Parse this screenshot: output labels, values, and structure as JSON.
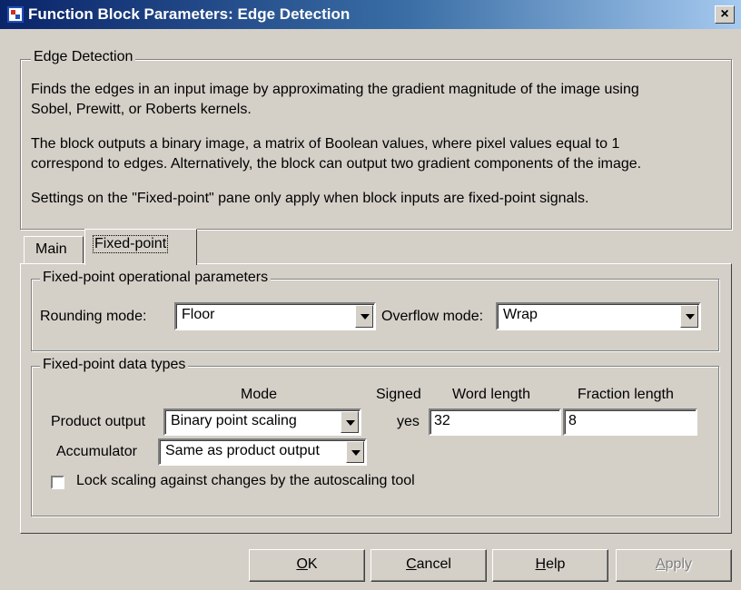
{
  "window": {
    "title": "Function Block Parameters: Edge Detection",
    "close_label": "×",
    "icon": "simulink-block-icon"
  },
  "description": {
    "group_title": "Edge Detection",
    "line1": "Finds the edges in an input image by approximating the gradient magnitude of the image using",
    "line2": "Sobel, Prewitt, or Roberts kernels.",
    "line3": "The block outputs a binary image, a matrix of Boolean values, where pixel values equal to 1",
    "line4": "correspond to edges.  Alternatively, the block can output two gradient components of the image.",
    "line5": "Settings on the \"Fixed-point\" pane only apply when block inputs are fixed-point signals."
  },
  "tabs": [
    {
      "label": "Main",
      "active": false
    },
    {
      "label": "Fixed-point",
      "active": true
    }
  ],
  "operational": {
    "group_title": "Fixed-point operational parameters",
    "rounding_label": "Rounding mode:",
    "rounding_value": "Floor",
    "overflow_label": "Overflow mode:",
    "overflow_value": "Wrap"
  },
  "datatypes": {
    "group_title": "Fixed-point data types",
    "headers": {
      "mode": "Mode",
      "signed": "Signed",
      "word_length": "Word length",
      "fraction_length": "Fraction length"
    },
    "product": {
      "label": "Product output",
      "mode": "Binary point scaling",
      "signed": "yes",
      "word_length": "32",
      "fraction_length": "8"
    },
    "accumulator": {
      "label": "Accumulator",
      "mode": "Same as product output"
    },
    "lock_label": "Lock scaling against changes by the autoscaling tool",
    "lock_checked": false
  },
  "buttons": {
    "ok": {
      "mnemonic": "O",
      "rest": "K"
    },
    "cancel": {
      "mnemonic": "C",
      "rest": "ancel"
    },
    "help": {
      "mnemonic": "H",
      "rest": "elp"
    },
    "apply": {
      "mnemonic": "A",
      "rest": "pply",
      "enabled": false
    }
  },
  "colors": {
    "titlebar_start": "#0a246a",
    "titlebar_end": "#a6caf0",
    "face": "#d4d0c8",
    "disabled_text": "#808080"
  }
}
